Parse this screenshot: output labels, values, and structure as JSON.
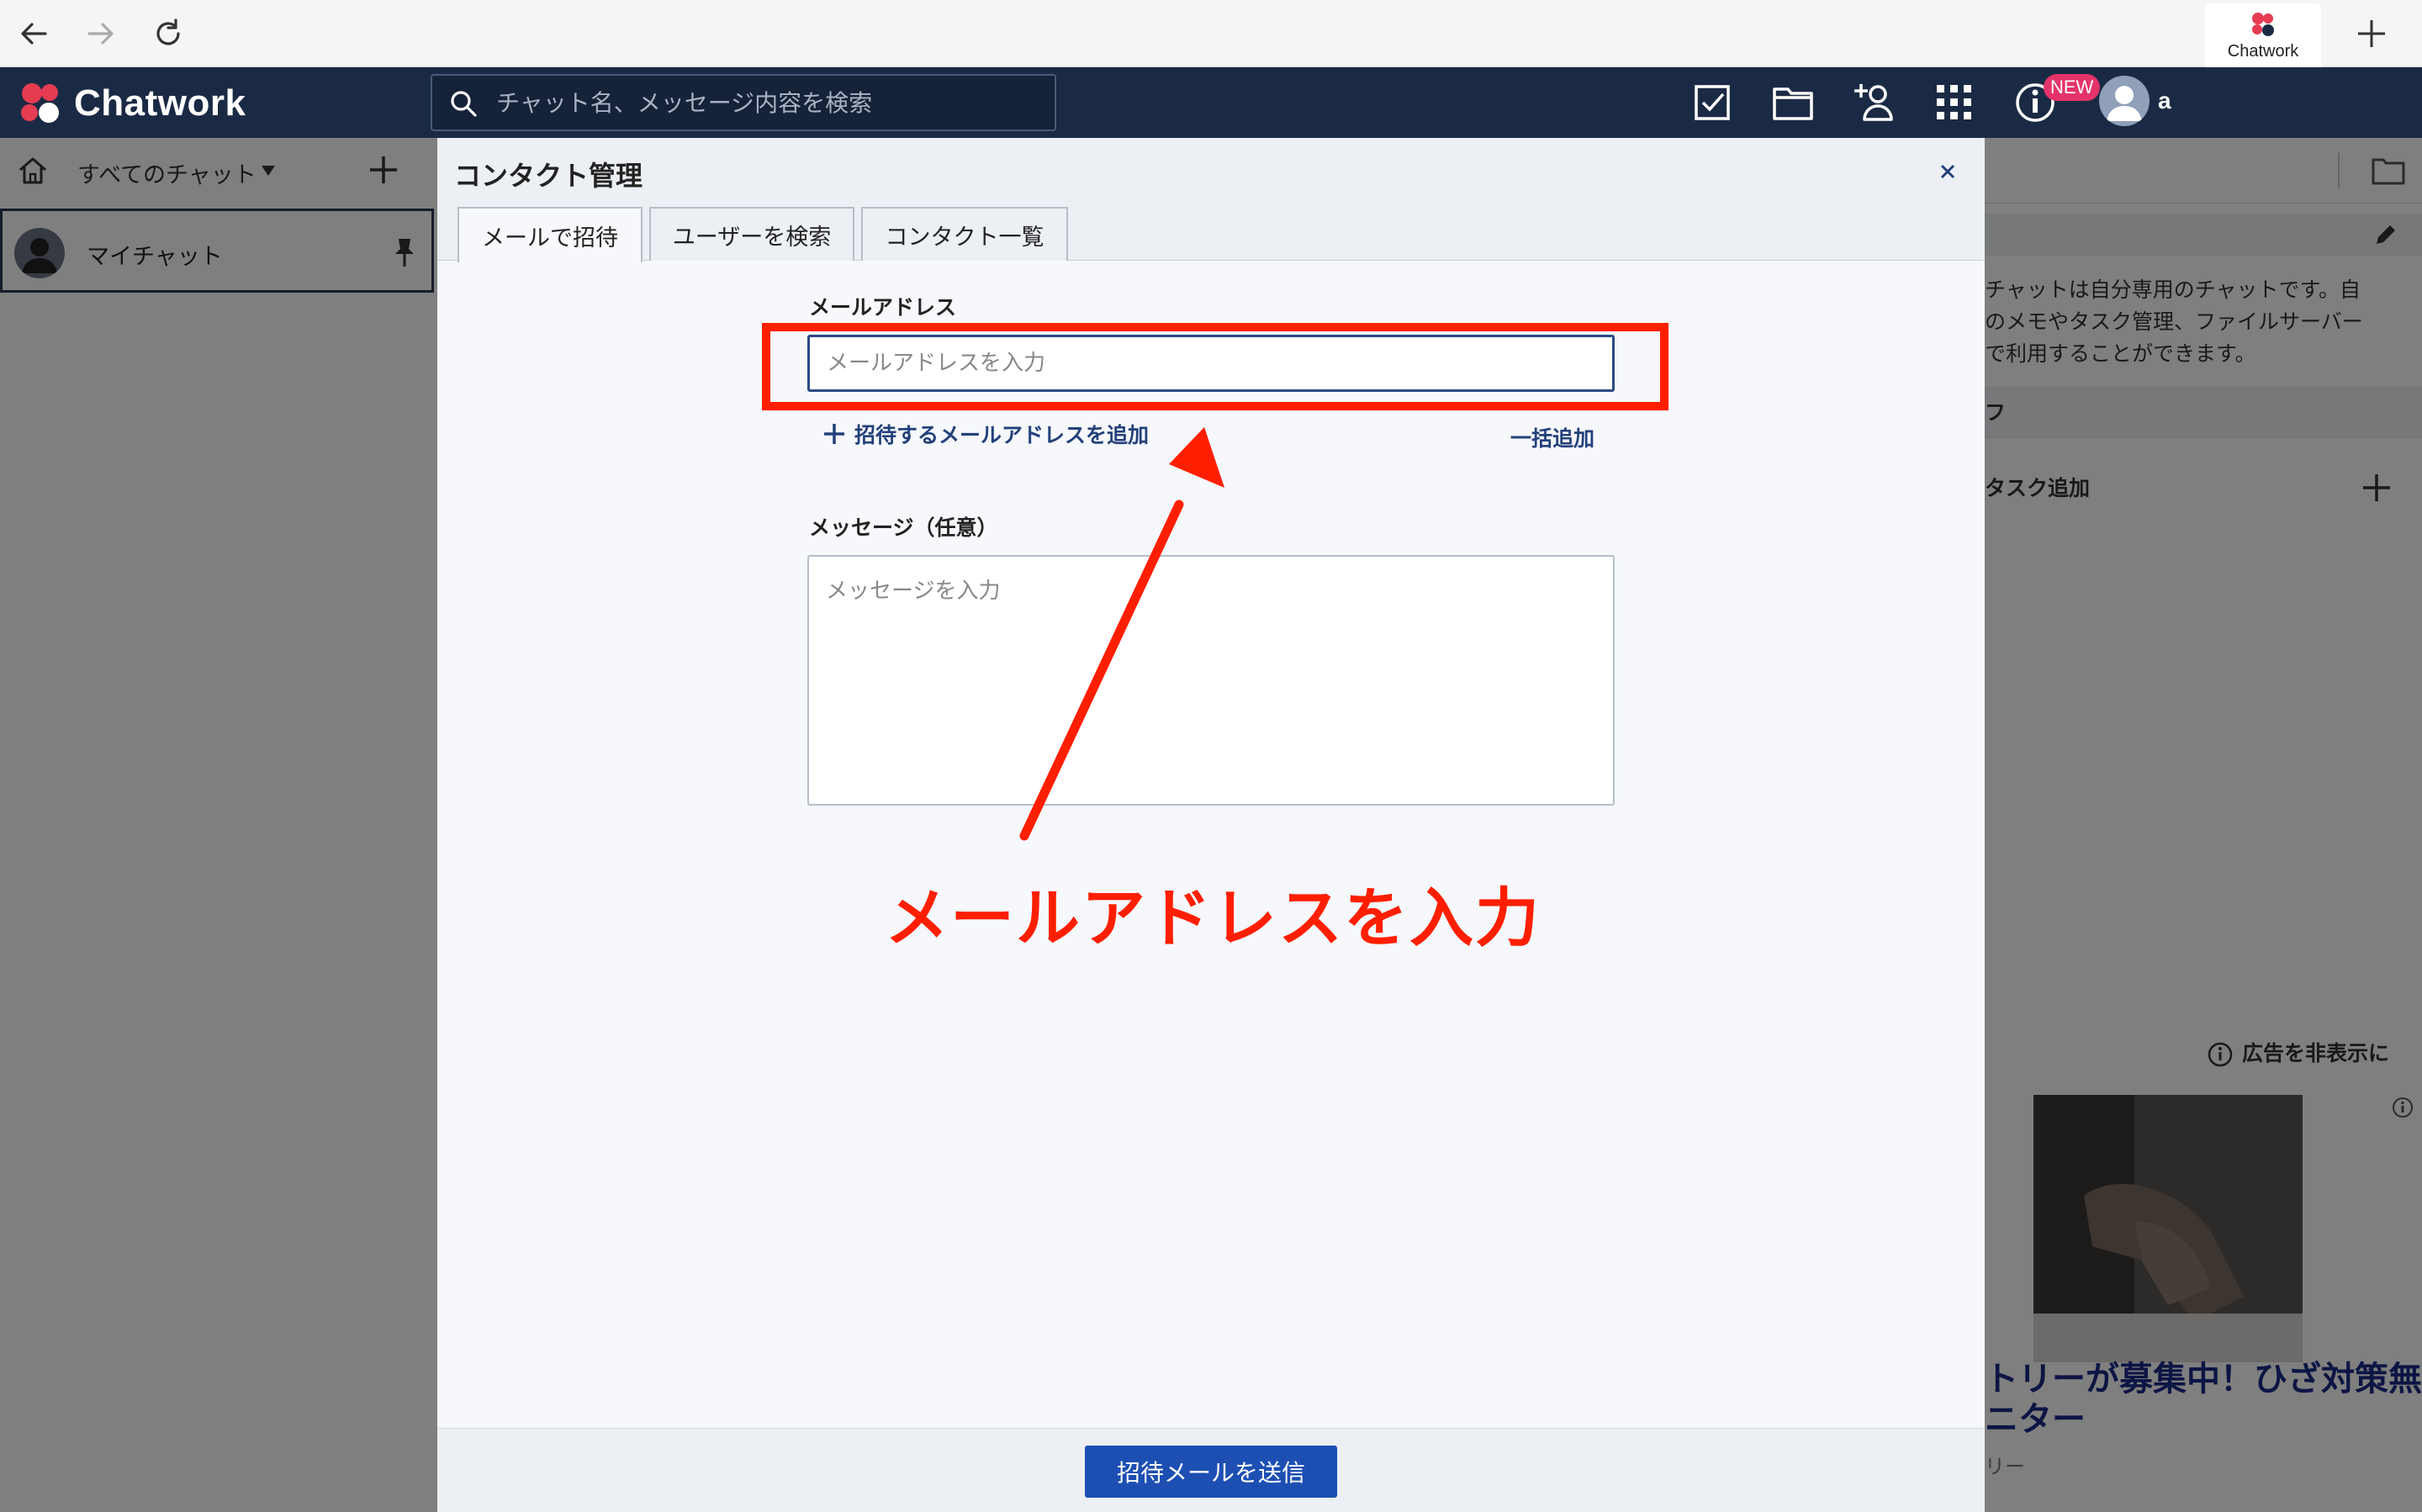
{
  "browser": {
    "tab_label": "Chatwork"
  },
  "header": {
    "logo_text": "Chatwork",
    "search_placeholder": "チャット名、メッセージ内容を検索",
    "new_badge": "NEW",
    "user_name": "a"
  },
  "sidebar": {
    "filter_label": "すべてのチャット",
    "my_chat_label": "マイチャット"
  },
  "right_panel": {
    "description_lines": [
      "チャットは自分専用のチャットです。自",
      "のメモやタスク管理、ファイルサーバー",
      "で利用することができます。"
    ],
    "section_label": "フ",
    "task_add_label": "タスク追加",
    "ad_hide_label": "広告を非表示に",
    "ad_title_line1": "トリーが募集中！ひざ対策無",
    "ad_title_line2": "ニター",
    "ad_sub": "リー"
  },
  "dialog": {
    "title": "コンタクト管理",
    "tabs": [
      {
        "label": "メールで招待",
        "active": true
      },
      {
        "label": "ユーザーを検索",
        "active": false
      },
      {
        "label": "コンタクト一覧",
        "active": false
      }
    ],
    "email_label": "メールアドレス",
    "email_placeholder": "メールアドレスを入力",
    "email_value": "",
    "add_email_link": "招待するメールアドレスを追加",
    "bulk_add_link": "一括追加",
    "message_label": "メッセージ（任意）",
    "message_placeholder": "メッセージを入力",
    "message_value": "",
    "send_button": "招待メールを送信"
  },
  "annotation": {
    "text": "メールアドレスを入力",
    "color": "#ff1f00"
  },
  "colors": {
    "header_bg": "#1b2a44",
    "primary_button": "#1d4fb3",
    "link": "#23407a",
    "badge": "#e5336a"
  }
}
